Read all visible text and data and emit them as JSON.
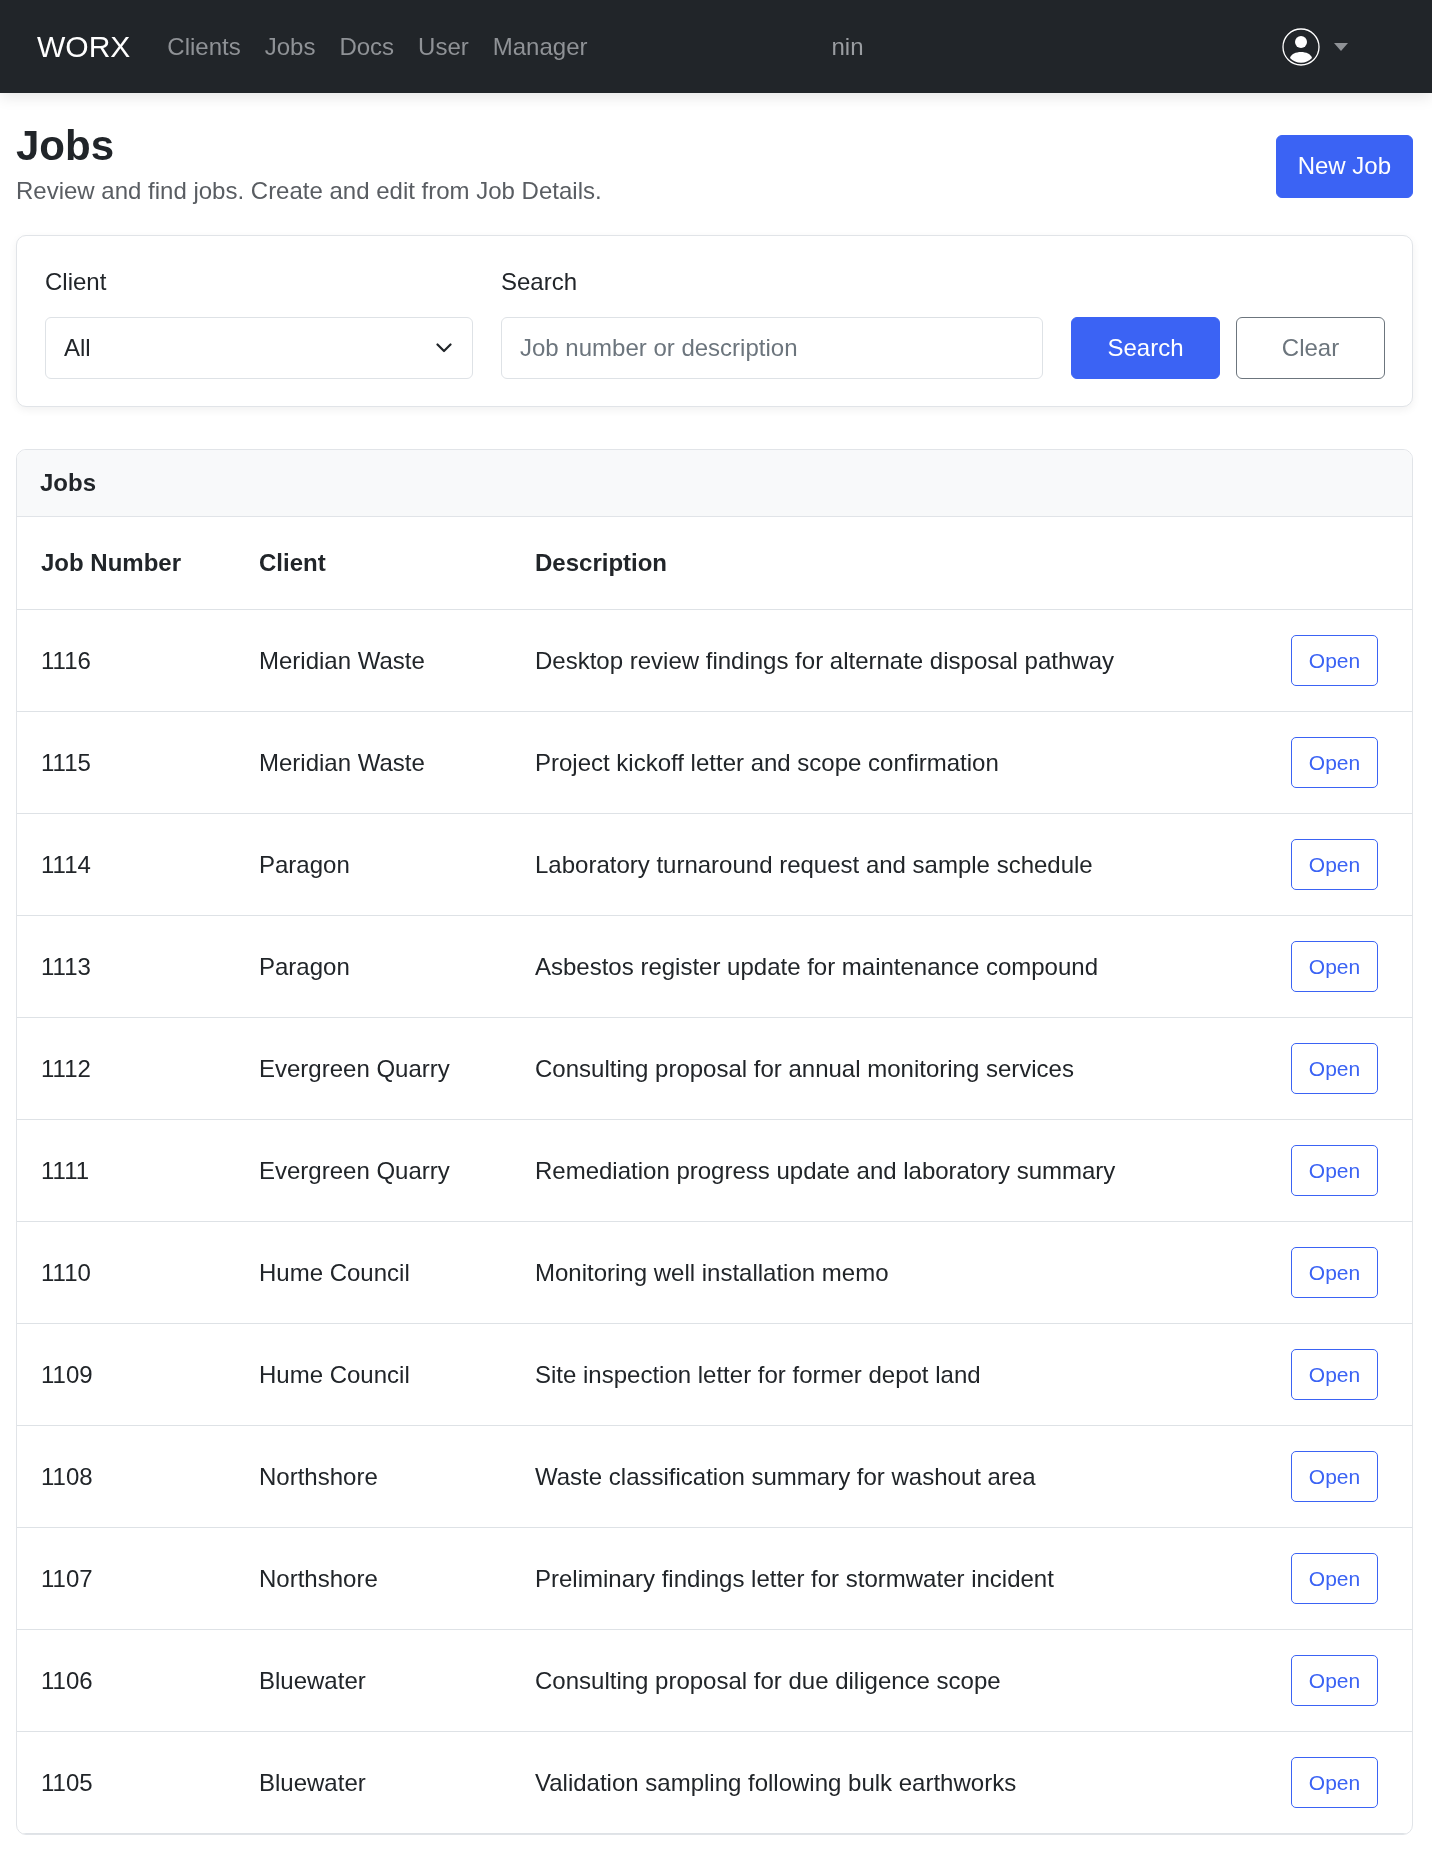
{
  "navbar": {
    "brand": "WORX",
    "links": [
      {
        "label": "Clients",
        "selected": false
      },
      {
        "label": "Jobs",
        "selected": false
      },
      {
        "label": "Docs",
        "selected": false
      },
      {
        "label": "User",
        "selected": false
      },
      {
        "label": "Manager",
        "selected": false
      }
    ],
    "fragment": "nin"
  },
  "header": {
    "title": "Jobs",
    "subtitle": "Review and find jobs. Create and edit from Job Details.",
    "new_button": "New Job"
  },
  "filters": {
    "client": {
      "label": "Client",
      "value": "All"
    },
    "search": {
      "label": "Search",
      "placeholder": "Job number or description"
    },
    "buttons": [
      {
        "label": "Search",
        "kind": "primary"
      },
      {
        "label": "Clear",
        "kind": "secondary"
      }
    ]
  },
  "jobs_table": {
    "title": "Jobs",
    "columns": [
      "Job Number",
      "Client",
      "Description"
    ],
    "rows": [
      {
        "job_number": "1116",
        "client": "Meridian Waste",
        "description": "Desktop review findings for alternate disposal pathway",
        "action": "Open"
      },
      {
        "job_number": "1115",
        "client": "Meridian Waste",
        "description": "Project kickoff letter and scope confirmation",
        "action": "Open"
      },
      {
        "job_number": "1114",
        "client": "Paragon",
        "description": "Laboratory turnaround request and sample schedule",
        "action": "Open"
      },
      {
        "job_number": "1113",
        "client": "Paragon",
        "description": "Asbestos register update for maintenance compound",
        "action": "Open"
      },
      {
        "job_number": "1112",
        "client": "Evergreen Quarry",
        "description": "Consulting proposal for annual monitoring services",
        "action": "Open"
      },
      {
        "job_number": "1111",
        "client": "Evergreen Quarry",
        "description": "Remediation progress update and laboratory summary",
        "action": "Open"
      },
      {
        "job_number": "1110",
        "client": "Hume Council",
        "description": "Monitoring well installation memo",
        "action": "Open"
      },
      {
        "job_number": "1109",
        "client": "Hume Council",
        "description": "Site inspection letter for former depot land",
        "action": "Open"
      },
      {
        "job_number": "1108",
        "client": "Northshore",
        "description": "Waste classification summary for washout area",
        "action": "Open"
      },
      {
        "job_number": "1107",
        "client": "Northshore",
        "description": "Preliminary findings letter for stormwater incident",
        "action": "Open"
      },
      {
        "job_number": "1106",
        "client": "Bluewater",
        "description": "Consulting proposal for due diligence scope",
        "action": "Open"
      },
      {
        "job_number": "1105",
        "client": "Bluewater",
        "description": "Validation sampling following bulk earthworks",
        "action": "Open"
      }
    ]
  }
}
